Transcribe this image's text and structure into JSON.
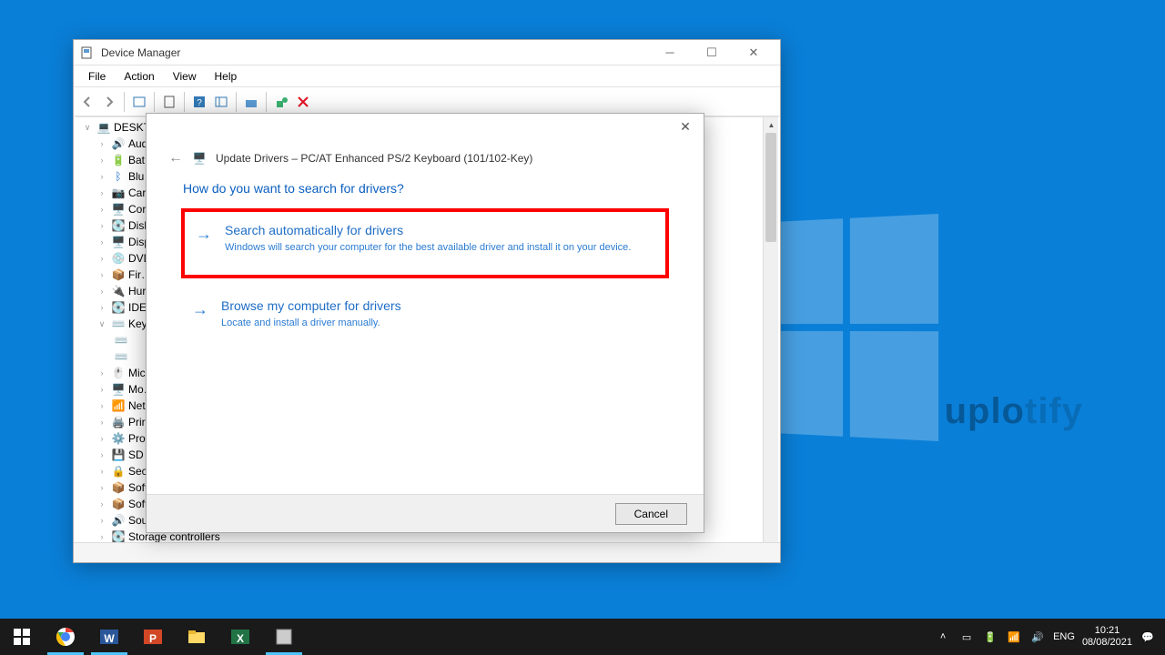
{
  "device_manager": {
    "title": "Device Manager",
    "menus": {
      "file": "File",
      "action": "Action",
      "view": "View",
      "help": "Help"
    },
    "root_node": "DESKTO…",
    "nodes": {
      "aud": "Aud…",
      "bat": "Bat…",
      "blu": "Blu…",
      "car": "Car…",
      "cor": "Cor…",
      "disk": "Disk…",
      "disp": "Disp…",
      "dvd": "DVD…",
      "fir": "Fir…",
      "hur": "Hur…",
      "ide": "IDE…",
      "key": "Key…",
      "mic": "Mic…",
      "mo": "Mo…",
      "net": "Net…",
      "prir": "Prir…",
      "pro": "Pro…",
      "sd": "SD …",
      "sec": "Sec…",
      "soft1": "Soft…",
      "soft2": "Soft…",
      "sou": "Sou…",
      "storage": "Storage controllers"
    }
  },
  "dialog": {
    "breadcrumb": "Update Drivers – PC/AT Enhanced PS/2 Keyboard (101/102-Key)",
    "question": "How do you want to search for drivers?",
    "option1": {
      "title": "Search automatically for drivers",
      "desc": "Windows will search your computer for the best available driver and install it on your device."
    },
    "option2": {
      "title": "Browse my computer for drivers",
      "desc": "Locate and install a driver manually."
    },
    "cancel": "Cancel"
  },
  "taskbar": {
    "lang": "ENG",
    "time": "10:21",
    "date": "08/08/2021"
  },
  "watermark": "uplotify"
}
